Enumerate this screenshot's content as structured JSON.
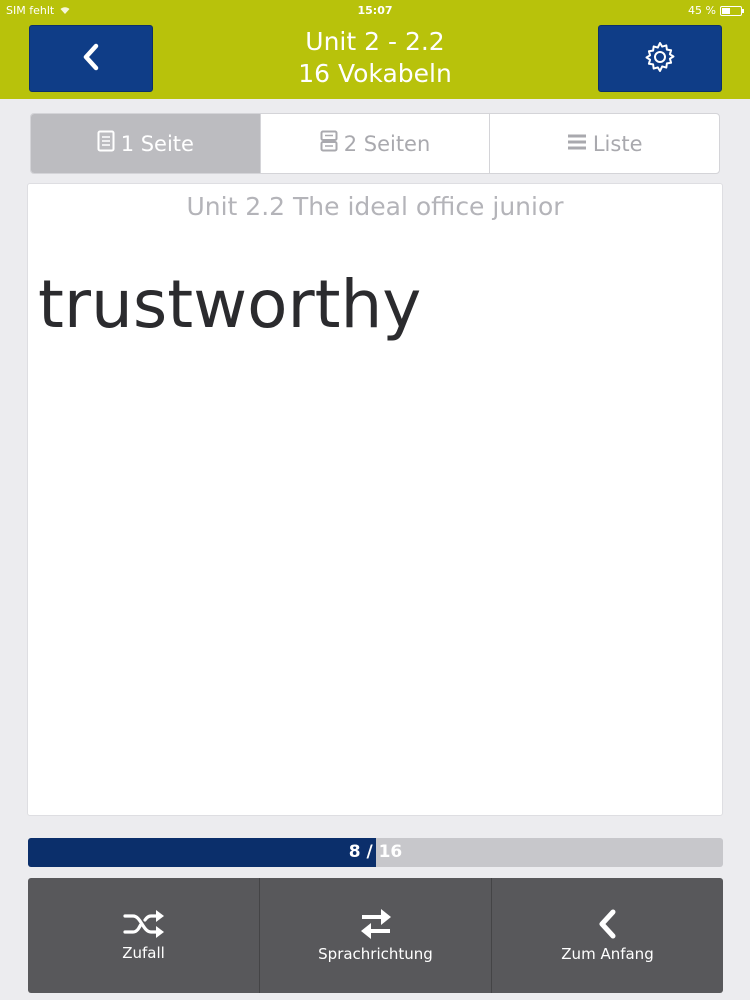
{
  "status": {
    "carrier": "SIM fehlt",
    "time": "15:07",
    "battery": "45 %",
    "battery_level": 0.45
  },
  "header": {
    "title_line1": "Unit 2 - 2.2",
    "title_line2": "16 Vokabeln",
    "back_icon": "chevron-left-icon",
    "settings_icon": "gear-icon"
  },
  "segments": [
    {
      "label": "1 Seite",
      "icon": "page-icon",
      "active": true
    },
    {
      "label": "2 Seiten",
      "icon": "two-pages-icon",
      "active": false
    },
    {
      "label": "Liste",
      "icon": "list-icon",
      "active": false
    }
  ],
  "card": {
    "title": "Unit 2.2 The ideal office junior",
    "word": "trustworthy"
  },
  "progress": {
    "label": "8 / 16",
    "current": 8,
    "total": 16
  },
  "toolbar": [
    {
      "label": "Zufall",
      "icon": "shuffle-icon"
    },
    {
      "label": "Sprachrichtung",
      "icon": "swap-arrows-icon"
    },
    {
      "label": "Zum Anfang",
      "icon": "chevron-left-icon"
    }
  ],
  "colors": {
    "header_bg": "#b8c20b",
    "button_bg": "#0f3d87",
    "progress_fill": "#0b2f6b",
    "toolbar_bg": "#58585b"
  }
}
